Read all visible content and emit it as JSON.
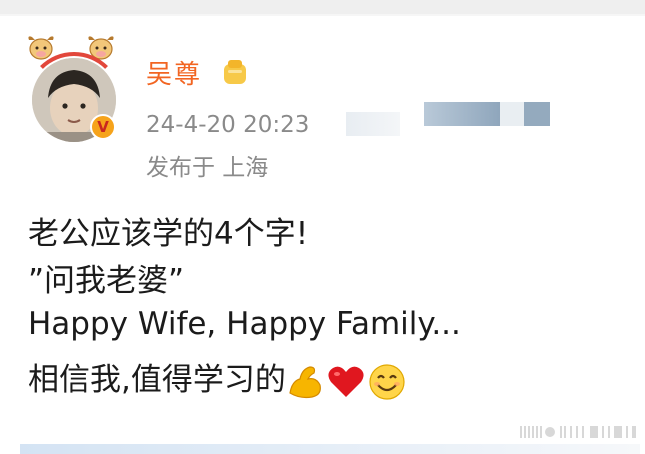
{
  "post": {
    "author": {
      "name": "吴尊",
      "avatar_icon": "child-photo-avatar",
      "frame_icon": "ox-new-year-frame-icon",
      "verified_icon": "verified-v-icon",
      "member_badge_icon": "gold-member-badge-icon"
    },
    "timestamp": "24-4-20 20:23",
    "location": "发布于 上海",
    "content": {
      "line1": "老公应该学的4个字!",
      "line2": "”问我老婆”",
      "line3": "Happy Wife, Happy Family...",
      "line4_text": "相信我,值得学习的",
      "line4_emojis": [
        "flexed-biceps-emoji",
        "red-heart-emoji",
        "smiling-face-emoji"
      ]
    }
  },
  "colors": {
    "author_name": "#f26522",
    "meta_text": "#8a8a8a",
    "body_text": "#1b1b1b",
    "verified_bg": "#f6a31b"
  }
}
